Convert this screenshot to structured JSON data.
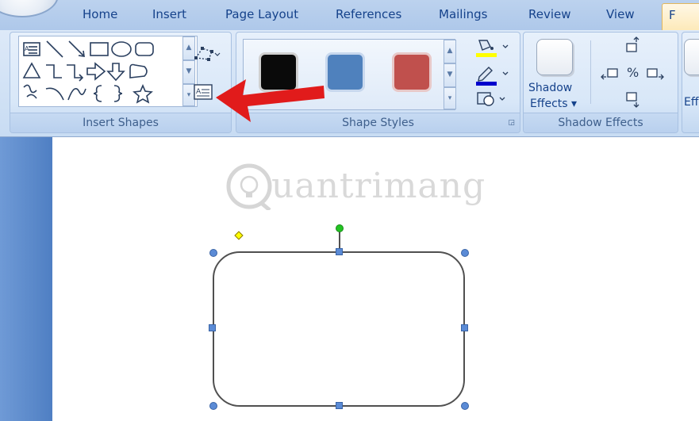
{
  "tabs": {
    "home": "Home",
    "insert": "Insert",
    "page_layout": "Page Layout",
    "references": "References",
    "mailings": "Mailings",
    "review": "Review",
    "view": "View",
    "format": "F"
  },
  "groups": {
    "insert_shapes": "Insert Shapes",
    "shape_styles": "Shape Styles",
    "shadow_effects": "Shadow Effects"
  },
  "shadow_button": {
    "line1": "Shadow",
    "line2": "Effects"
  },
  "cut_button": "Eff",
  "style_swatches": [
    "#0a0a0a",
    "#4f81bd",
    "#c0504d"
  ],
  "colors": {
    "fill_underline": "#ffff00",
    "outline_underline": "#0000cc",
    "arrow": "#e11b1b",
    "rotate_handle": "#22c422",
    "adjust_handle": "#ffff00"
  },
  "watermark": "uantrimang"
}
